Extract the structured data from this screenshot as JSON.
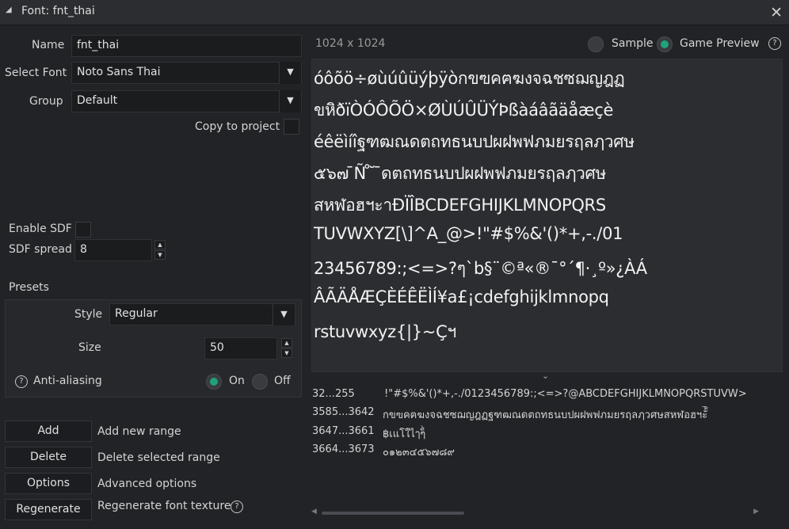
{
  "title": "Font: fnt_thai",
  "name": {
    "label": "Name",
    "value": "fnt_thai"
  },
  "select_font": {
    "label": "Select Font",
    "value": "Noto Sans Thai"
  },
  "group": {
    "label": "Group",
    "value": "Default"
  },
  "copy_to_project": {
    "label": "Copy to project",
    "checked": false
  },
  "enable_sdf": {
    "label": "Enable SDF",
    "checked": false
  },
  "sdf_spread": {
    "label": "SDF spread",
    "value": "8"
  },
  "presets": {
    "label": "Presets",
    "style": {
      "label": "Style",
      "value": "Regular"
    },
    "size": {
      "label": "Size",
      "value": "50"
    },
    "anti_aliasing": {
      "label": "Anti-aliasing",
      "on_label": "On",
      "off_label": "Off",
      "selected": "On"
    }
  },
  "buttons": [
    {
      "label": "Add",
      "description": "Add new range"
    },
    {
      "label": "Delete",
      "description": "Delete selected range"
    },
    {
      "label": "Options",
      "description": "Advanced options"
    },
    {
      "label": "Regenerate",
      "description": "Regenerate font texture"
    }
  ],
  "preview": {
    "texture_size": "1024 x 1024",
    "sample_label": "Sample",
    "game_preview_label": "Game Preview",
    "mode": "Game Preview",
    "glyph_lines": [
      " óôõö÷øùúûüýþÿòกขฃคฅฆงจฉชซฌญฎฏ",
      "ขหิðïÒÓÔÕÖ×ØÙÚÛÜÝÞßàáâãäåæçè",
      "éêëìíîฐฑฒณดตถทธนบปผฝพฟภมยรฤลฦวศษ",
      "๕๖๗ ̄Ñ ̊ ̆ ̄ดตถทธนบปผฝพฟภมยรฤลฦวศษ",
      "สหฬอฮฯะาÐÏÎBCDEFGHIJKLMNOPQRS",
      "TUVWXYZ[\\]^A_@>!\"#$%&'()*+,-./01",
      "23456789:;<=>?ๆ`b§¨©ª«®¯°´¶·¸º»¿ÀÁ",
      "ÂÃÄÅÆÇÈÉÊËÌÍ¥a£¡cdefghijklmnopq",
      "rstuvwxyz{|}~Çฯ"
    ],
    "expand_icon": "chevrons-down-icon"
  },
  "ranges": [
    {
      "range": "32...255",
      "chars": "!\"#$%&'()*+,-./0123456789:;<=>?@ABCDEFGHIJKLMNOPQRSTUVW>"
    },
    {
      "range": "3585...3642",
      "chars": "กขฃคฅฆงจฉชซฌญฎฏฐฑฒณดตถทธนบปผฝพฟภมยรฤลฦวศษสหฬอฮฯะั้ิ๊ี"
    },
    {
      "range": "3647...3661",
      "chars": "฿เแโใไๅๆ็่้๊๋์ํ"
    },
    {
      "range": "3664...3673",
      "chars": "๐๑๒๓๔๕๖๗๘๙"
    }
  ],
  "colors": {
    "accent": "#1fa37a",
    "background": "#222326",
    "panel": "#2c2d31"
  }
}
